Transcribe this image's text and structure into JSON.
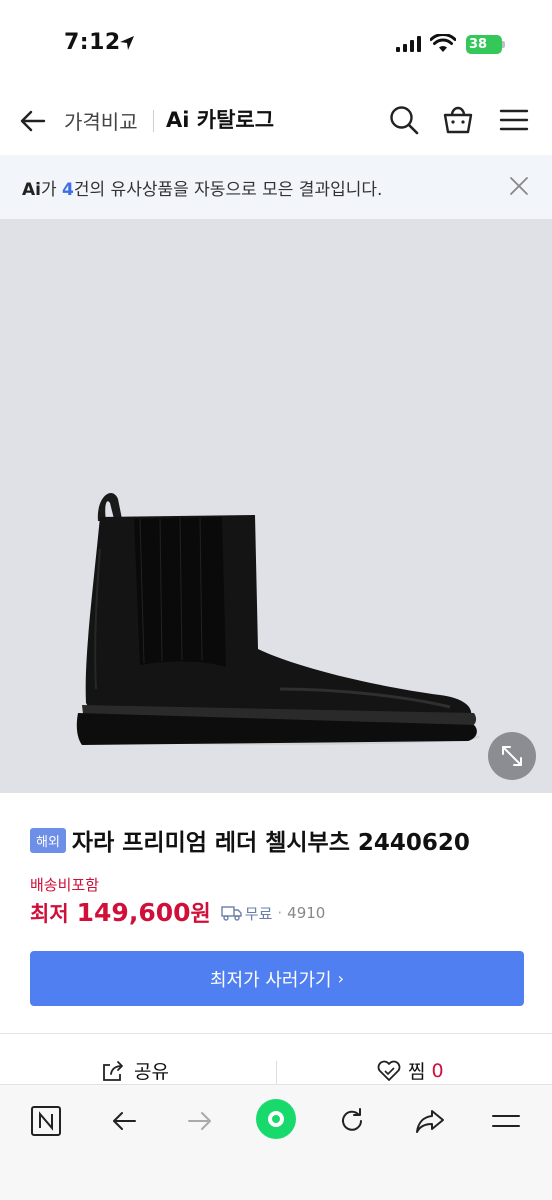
{
  "status": {
    "time": "7:12",
    "battery": "38"
  },
  "nav": {
    "back_icon": "arrow-left-icon",
    "price_compare": "가격비교",
    "ai_catalog": "Ai 카탈로그"
  },
  "banner": {
    "ai": "Ai",
    "pre": "가 ",
    "count": "4",
    "post": "건의 유사상품을 자동으로 모은 결과입니다."
  },
  "product": {
    "badge": "해외",
    "title": "자라 프리미엄 레더 첼시부츠 2440620",
    "shipping_included": "배송비포함",
    "price_label": "최저",
    "price_value": "149,600",
    "price_unit": "원",
    "delivery_free": "무료",
    "delivery_code": "4910"
  },
  "buy_button": {
    "label": "최저가 사러가기",
    "chevron": "›"
  },
  "actions": {
    "share": "공유",
    "like": "찜",
    "like_count": "0"
  },
  "colors": {
    "accent": "#4f7ff0",
    "price": "#d0103a",
    "naver_green": "#18d96b",
    "image_bg": "#dfe1e6"
  }
}
